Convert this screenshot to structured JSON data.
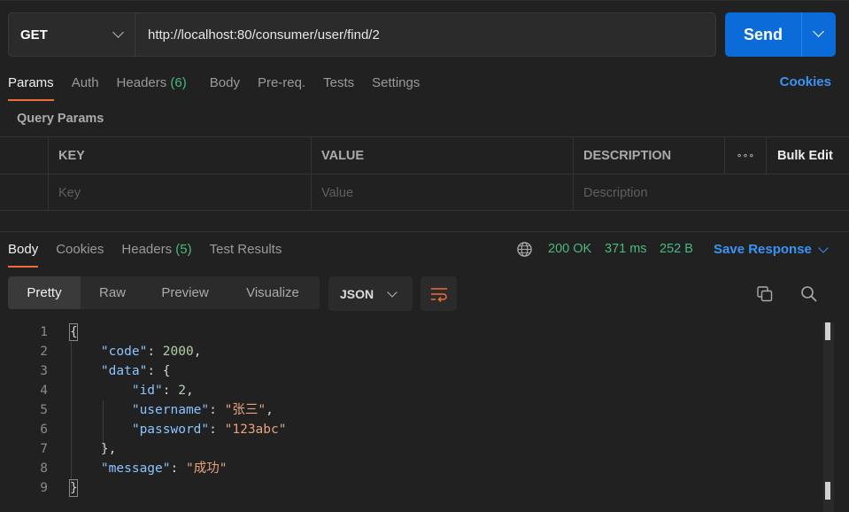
{
  "request": {
    "method": "GET",
    "url": "http://localhost:80/consumer/user/find/2",
    "send_label": "Send"
  },
  "request_tabs": {
    "params": "Params",
    "auth": "Auth",
    "headers": "Headers",
    "headers_count": "(6)",
    "body": "Body",
    "prereq": "Pre-req.",
    "tests": "Tests",
    "settings": "Settings",
    "cookies": "Cookies"
  },
  "query_params": {
    "title": "Query Params",
    "col_key": "KEY",
    "col_value": "VALUE",
    "col_description": "DESCRIPTION",
    "more": "∘∘∘",
    "bulk_edit": "Bulk Edit",
    "ph_key": "Key",
    "ph_value": "Value",
    "ph_description": "Description"
  },
  "response_tabs": {
    "body": "Body",
    "cookies": "Cookies",
    "headers": "Headers",
    "headers_count": "(5)",
    "test_results": "Test Results"
  },
  "response_meta": {
    "status": "200 OK",
    "time": "371 ms",
    "size": "252 B",
    "save_response": "Save Response"
  },
  "view_modes": {
    "pretty": "Pretty",
    "raw": "Raw",
    "preview": "Preview",
    "visualize": "Visualize",
    "format": "JSON"
  },
  "code_lines": {
    "l1": "1",
    "l2": "2",
    "l3": "3",
    "l4": "4",
    "l5": "5",
    "l6": "6",
    "l7": "7",
    "l8": "8",
    "l9": "9"
  },
  "json_body": {
    "k_code": "\"code\"",
    "v_code": "2000",
    "k_data": "\"data\"",
    "k_id": "\"id\"",
    "v_id": "2",
    "k_username": "\"username\"",
    "v_username": "\"张三\"",
    "k_password": "\"password\"",
    "v_password": "\"123abc\"",
    "k_message": "\"message\"",
    "v_message": "\"成功\""
  },
  "colors": {
    "accent": "#f26b3a",
    "send": "#0b6bd8",
    "link": "#3a93f5",
    "success": "#49b97d"
  }
}
